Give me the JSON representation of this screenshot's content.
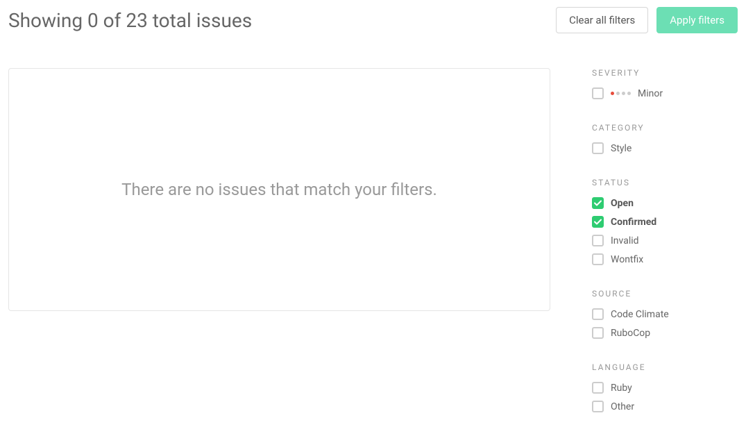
{
  "header": {
    "title": "Showing 0 of 23 total issues",
    "clear_label": "Clear all filters",
    "apply_label": "Apply filters"
  },
  "main": {
    "empty_message": "There are no issues that match your filters."
  },
  "filters": {
    "severity": {
      "heading": "SEVERITY",
      "items": {
        "minor": "Minor"
      }
    },
    "category": {
      "heading": "CATEGORY",
      "items": {
        "style": "Style"
      }
    },
    "status": {
      "heading": "STATUS",
      "items": {
        "open": "Open",
        "confirmed": "Confirmed",
        "invalid": "Invalid",
        "wontfix": "Wontfix"
      }
    },
    "source": {
      "heading": "SOURCE",
      "items": {
        "code_climate": "Code Climate",
        "rubocop": "RuboCop"
      }
    },
    "language": {
      "heading": "LANGUAGE",
      "items": {
        "ruby": "Ruby",
        "other": "Other"
      }
    }
  }
}
